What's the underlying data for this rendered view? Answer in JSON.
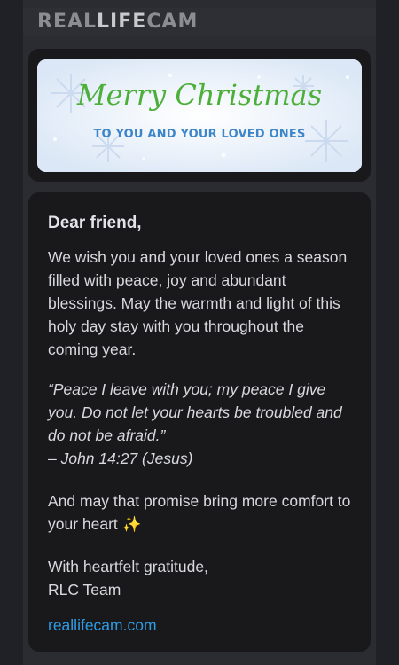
{
  "header": {
    "logo_a": "REAL",
    "logo_b": "LIFE",
    "logo_c": "CAM"
  },
  "banner": {
    "title": "Merry Christmas",
    "subtitle": "TO YOU AND YOUR LOVED ONES"
  },
  "message": {
    "greeting": "Dear friend,",
    "paragraph1": "We wish you and your loved ones a season filled with peace, joy and abundant blessings. May the warmth and light of this holy day stay with you throughout the coming year.",
    "quote": "“Peace I leave with you; my peace I give you. Do not let your hearts be troubled and do not be afraid.”",
    "citation": "– John 14:27 (Jesus)",
    "paragraph2": "And may that promise bring more comfort to your heart ✨",
    "signoff": "With heartfelt gratitude,",
    "signature": "RLC Team",
    "link": "reallifecam.com"
  }
}
